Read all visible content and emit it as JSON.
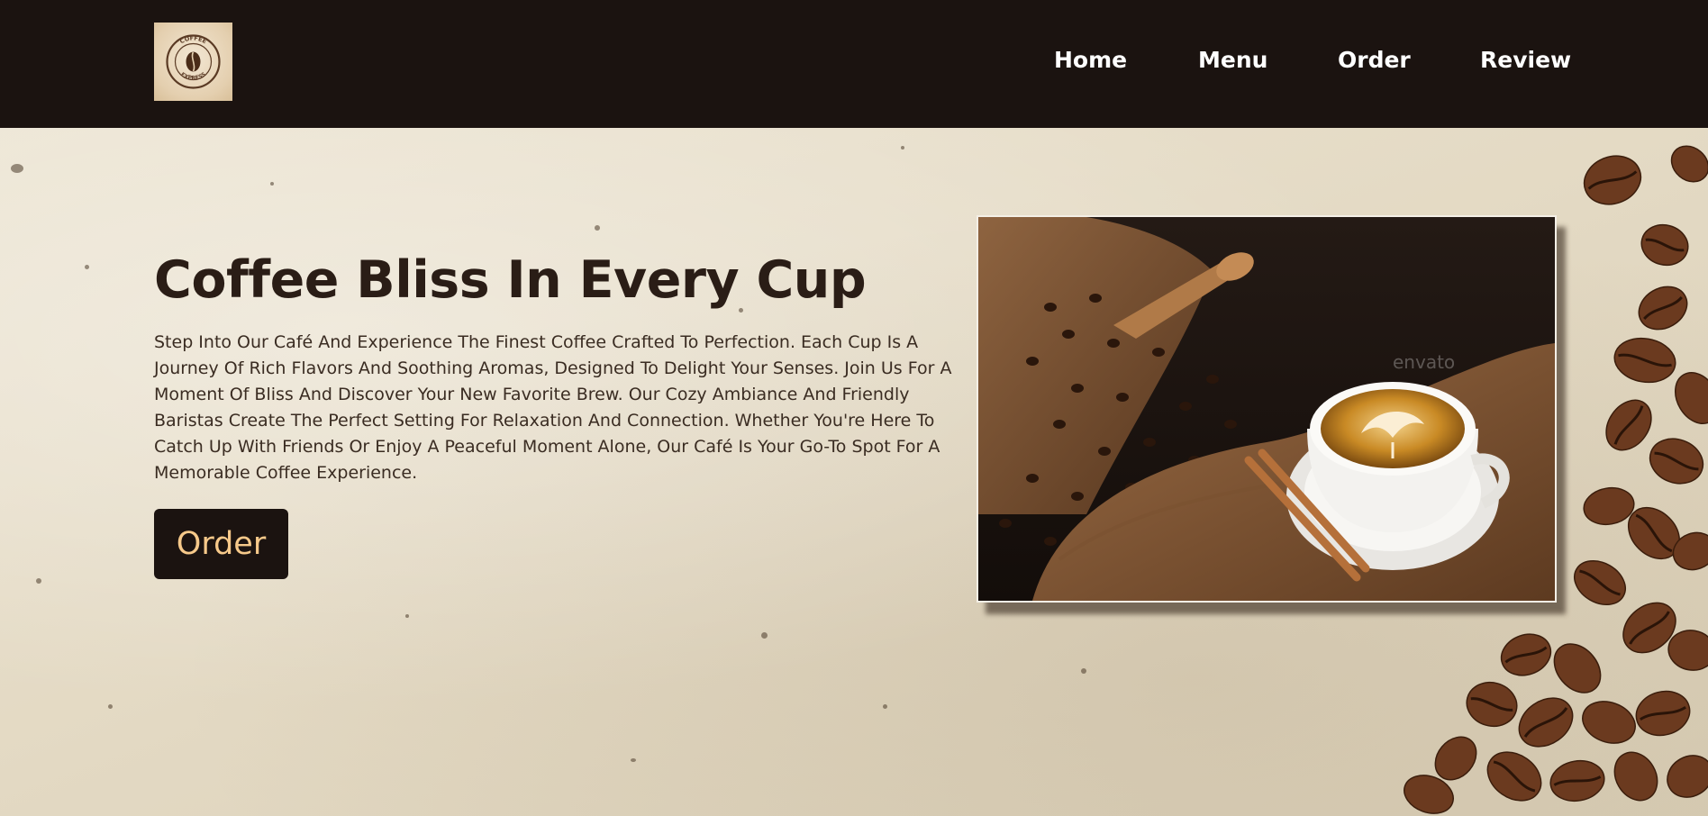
{
  "brand": {
    "logo_top_text": "COFFEE",
    "logo_bottom_text": "EXPRESS"
  },
  "nav": {
    "items": [
      {
        "label": "Home"
      },
      {
        "label": "Menu"
      },
      {
        "label": "Order"
      },
      {
        "label": "Review"
      }
    ]
  },
  "hero": {
    "title": "Coffee Bliss In Every Cup",
    "description": "Step Into Our Café And Experience The Finest Coffee Crafted To Perfection. Each Cup Is A Journey Of Rich Flavors And Soothing Aromas, Designed To Delight Your Senses. Join Us For A Moment Of Bliss And Discover Your New Favorite Brew. Our Cozy Ambiance And Friendly Baristas Create The Perfect Setting For Relaxation And Connection. Whether You're Here To Catch Up With Friends Or Enjoy A Peaceful Moment Alone, Our Café Is Your Go-To Spot For A Memorable Coffee Experience.",
    "order_label": "Order",
    "photo_watermark": "envato"
  },
  "colors": {
    "nav_bg": "#1b1310",
    "button_text": "#f6c98a",
    "title_text": "#2a1d16"
  }
}
